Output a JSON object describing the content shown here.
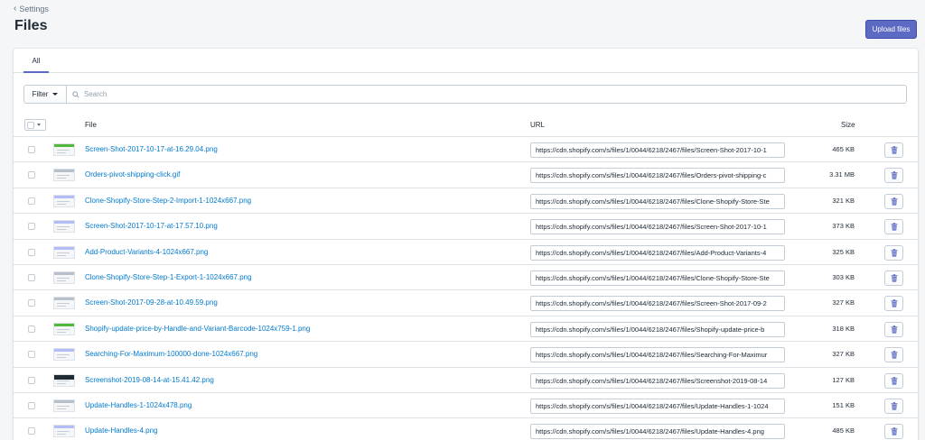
{
  "header": {
    "back_label": "Settings",
    "title": "Files",
    "upload_label": "Upload files"
  },
  "tabs": [
    {
      "label": "All"
    }
  ],
  "toolbar": {
    "filter_label": "Filter",
    "search_placeholder": "Search"
  },
  "table": {
    "columns": {
      "file": "File",
      "url": "URL",
      "size": "Size"
    },
    "rows": [
      {
        "name": "Screen-Shot-2017-10-17-at-16.29.04.png",
        "url": "https://cdn.shopify.com/s/files/1/0044/6218/2467/files/Screen-Shot-2017-10-1",
        "size": "465 KB",
        "thumb": "green"
      },
      {
        "name": "Orders-pivot-shipping-click.gif",
        "url": "https://cdn.shopify.com/s/files/1/0044/6218/2467/files/Orders-pivot-shipping-c",
        "size": "3.31 MB",
        "thumb": "plain"
      },
      {
        "name": "Clone-Shopify-Store-Step-2-Import-1-1024x667.png",
        "url": "https://cdn.shopify.com/s/files/1/0044/6218/2467/files/Clone-Shopify-Store-Ste",
        "size": "321 KB",
        "thumb": "purple"
      },
      {
        "name": "Screen-Shot-2017-10-17-at-17.57.10.png",
        "url": "https://cdn.shopify.com/s/files/1/0044/6218/2467/files/Screen-Shot-2017-10-1",
        "size": "373 KB",
        "thumb": "purple"
      },
      {
        "name": "Add-Product-Variants-4-1024x667.png",
        "url": "https://cdn.shopify.com/s/files/1/0044/6218/2467/files/Add-Product-Variants-4",
        "size": "325 KB",
        "thumb": "purple"
      },
      {
        "name": "Clone-Shopify-Store-Step-1-Export-1-1024x667.png",
        "url": "https://cdn.shopify.com/s/files/1/0044/6218/2467/files/Clone-Shopify-Store-Ste",
        "size": "303 KB",
        "thumb": "plain"
      },
      {
        "name": "Screen-Shot-2017-09-28-at-10.49.59.png",
        "url": "https://cdn.shopify.com/s/files/1/0044/6218/2467/files/Screen-Shot-2017-09-2",
        "size": "327 KB",
        "thumb": "plain"
      },
      {
        "name": "Shopify-update-price-by-Handle-and-Variant-Barcode-1024x759-1.png",
        "url": "https://cdn.shopify.com/s/files/1/0044/6218/2467/files/Shopify-update-price-b",
        "size": "318 KB",
        "thumb": "green"
      },
      {
        "name": "Searching-For-Maximum-100000-done-1024x667.png",
        "url": "https://cdn.shopify.com/s/files/1/0044/6218/2467/files/Searching-For-Maximur",
        "size": "327 KB",
        "thumb": "purple"
      },
      {
        "name": "Screenshot-2019-08-14-at-15.41.42.png",
        "url": "https://cdn.shopify.com/s/files/1/0044/6218/2467/files/Screenshot-2019-08-14",
        "size": "127 KB",
        "thumb": "dark"
      },
      {
        "name": "Update-Handles-1-1024x478.png",
        "url": "https://cdn.shopify.com/s/files/1/0044/6218/2467/files/Update-Handles-1-1024",
        "size": "151 KB",
        "thumb": "plain"
      },
      {
        "name": "Update-Handles-4.png",
        "url": "https://cdn.shopify.com/s/files/1/0044/6218/2467/files/Update-Handles-4.png",
        "size": "485 KB",
        "thumb": "purple"
      }
    ]
  },
  "colors": {
    "accent": "#5c6ac4",
    "link": "#007ace",
    "background": "#f4f6f8"
  },
  "icons": {
    "back": "chevron-left-icon",
    "search": "search-icon",
    "delete": "trash-icon"
  }
}
